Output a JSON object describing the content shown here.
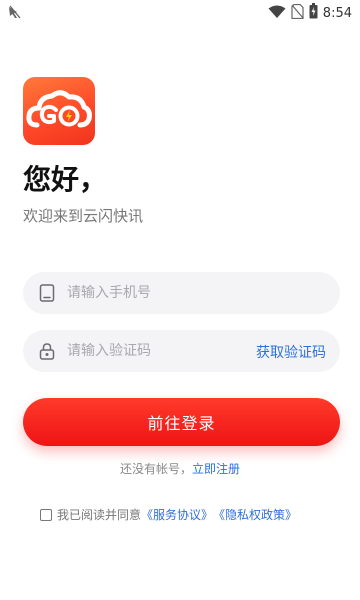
{
  "status_bar": {
    "time": "8:54",
    "icons": [
      "app-notification-icon",
      "wifi-icon",
      "no-sim-icon",
      "battery-icon"
    ]
  },
  "logo": {
    "icon": "cloud-lightning-logo",
    "colors": {
      "primary": "#ff4a2a"
    }
  },
  "greeting": "您好，",
  "subtitle": "欢迎来到云闪快讯",
  "phone_field": {
    "placeholder": "请输入手机号",
    "icon": "phone-icon"
  },
  "code_field": {
    "placeholder": "请输入验证码",
    "icon": "lock-icon",
    "get_code_label": "获取验证码"
  },
  "login_button": {
    "label": "前往登录",
    "color": "#ee1414"
  },
  "register": {
    "prompt": "还没有帐号，",
    "link": "立即注册"
  },
  "agreement": {
    "text": "我已阅读并同意",
    "service_link": "《服务协议》",
    "privacy_link": "《隐私权政策》",
    "checked": false
  },
  "colors": {
    "link": "#2f6fdb",
    "accent": "#ee1414"
  }
}
